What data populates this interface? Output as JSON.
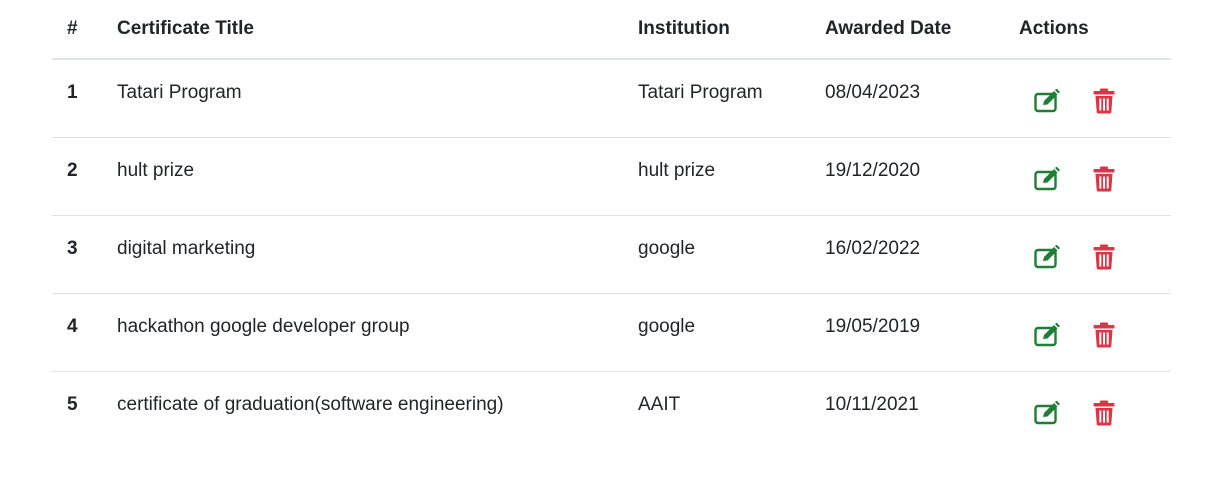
{
  "table": {
    "headers": {
      "num": "#",
      "title": "Certificate Title",
      "institution": "Institution",
      "date": "Awarded Date",
      "actions": "Actions"
    },
    "rows": [
      {
        "num": "1",
        "title": "Tatari Program",
        "institution": "Tatari Program",
        "date": "08/04/2023"
      },
      {
        "num": "2",
        "title": "hult prize",
        "institution": "hult prize",
        "date": "19/12/2020"
      },
      {
        "num": "3",
        "title": "digital marketing",
        "institution": "google",
        "date": "16/02/2022"
      },
      {
        "num": "4",
        "title": "hackathon google developer group",
        "institution": "google",
        "date": "19/05/2019"
      },
      {
        "num": "5",
        "title": "certificate of graduation(software engineering)",
        "institution": "AAIT",
        "date": "10/11/2021"
      }
    ],
    "action_icons": {
      "edit": "edit-icon",
      "delete": "trash-icon"
    }
  },
  "colors": {
    "edit": "#1e7e34",
    "delete": "#dc3545",
    "border": "#dee2e6",
    "text": "#212529"
  }
}
